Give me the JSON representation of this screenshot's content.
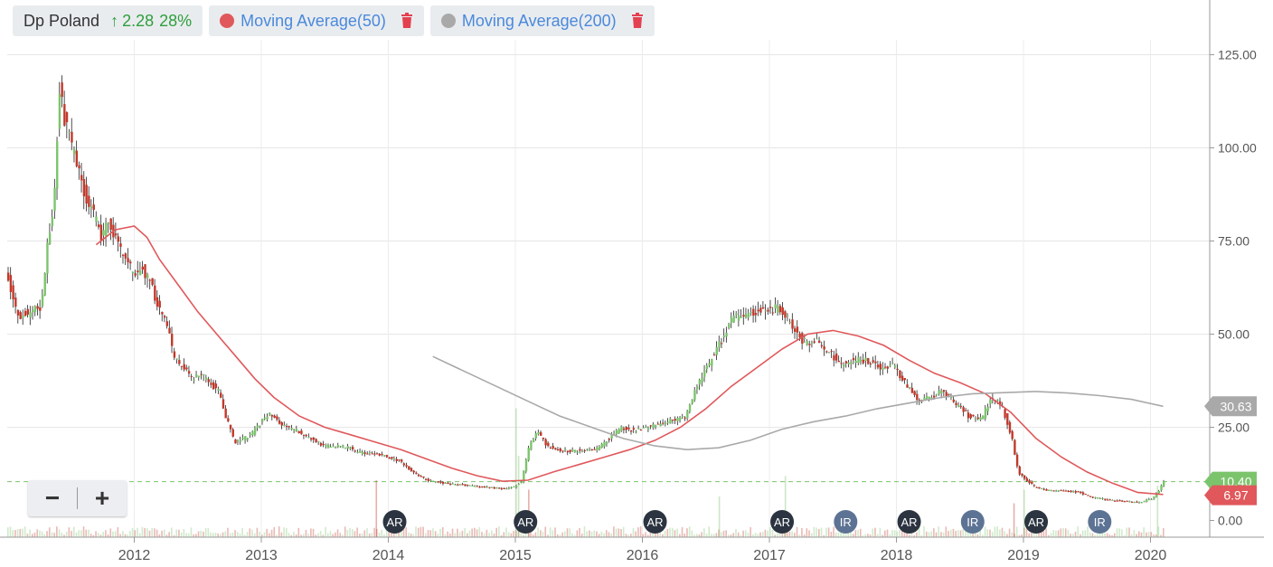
{
  "legend": {
    "ticker": "Dp Poland",
    "change_arrow": "↑",
    "change_value": "2.28",
    "change_pct": "28%",
    "ma50": {
      "label": "Moving Average(50)",
      "color": "#e0585b"
    },
    "ma200": {
      "label": "Moving Average(200)",
      "color": "#a9a9a9"
    }
  },
  "zoom": {
    "out_label": "−",
    "in_label": "+"
  },
  "chart_data": {
    "type": "candlestick",
    "x_axis": {
      "tick_labels": [
        "2012",
        "2013",
        "2014",
        "2015",
        "2016",
        "2017",
        "2018",
        "2019",
        "2020"
      ],
      "range": [
        2011.0,
        2020.27
      ]
    },
    "y_axis": {
      "position": "right",
      "tick_labels": [
        "125.00",
        "100.00",
        "75.00",
        "50.00",
        "25.00",
        "0.00"
      ],
      "range": [
        -3,
        135
      ]
    },
    "price_tags": [
      {
        "label": "30.63",
        "value": 30.63,
        "color": "#a9a9a9"
      },
      {
        "label": "10.40",
        "value": 10.4,
        "color": "#7cc46c"
      },
      {
        "label": "6.97",
        "value": 6.97,
        "color": "#e0585b"
      }
    ],
    "current_price_line": 10.4,
    "price_points": [
      [
        2011.0,
        68
      ],
      [
        2011.05,
        60
      ],
      [
        2011.1,
        55
      ],
      [
        2011.2,
        56
      ],
      [
        2011.28,
        57
      ],
      [
        2011.33,
        75
      ],
      [
        2011.38,
        85
      ],
      [
        2011.42,
        116
      ],
      [
        2011.48,
        105
      ],
      [
        2011.54,
        98
      ],
      [
        2011.6,
        90
      ],
      [
        2011.67,
        84
      ],
      [
        2011.75,
        76
      ],
      [
        2011.82,
        80
      ],
      [
        2011.88,
        74
      ],
      [
        2011.95,
        70
      ],
      [
        2012.0,
        66
      ],
      [
        2012.07,
        68
      ],
      [
        2012.13,
        64
      ],
      [
        2012.2,
        58
      ],
      [
        2012.27,
        52
      ],
      [
        2012.33,
        43
      ],
      [
        2012.4,
        41
      ],
      [
        2012.47,
        38
      ],
      [
        2012.54,
        39
      ],
      [
        2012.6,
        37
      ],
      [
        2012.67,
        35
      ],
      [
        2012.73,
        28
      ],
      [
        2012.8,
        21
      ],
      [
        2012.87,
        22
      ],
      [
        2012.93,
        23
      ],
      [
        2013.0,
        26
      ],
      [
        2013.07,
        29
      ],
      [
        2013.13,
        27
      ],
      [
        2013.2,
        25
      ],
      [
        2013.3,
        24
      ],
      [
        2013.4,
        22
      ],
      [
        2013.5,
        20
      ],
      [
        2013.6,
        20
      ],
      [
        2013.7,
        19.5
      ],
      [
        2013.8,
        18
      ],
      [
        2013.9,
        18
      ],
      [
        2014.0,
        17
      ],
      [
        2014.1,
        16
      ],
      [
        2014.2,
        13
      ],
      [
        2014.3,
        11
      ],
      [
        2014.45,
        10
      ],
      [
        2014.6,
        9.5
      ],
      [
        2014.75,
        9
      ],
      [
        2014.9,
        8.5
      ],
      [
        2015.0,
        9
      ],
      [
        2015.06,
        10.5
      ],
      [
        2015.12,
        20
      ],
      [
        2015.18,
        24
      ],
      [
        2015.26,
        20
      ],
      [
        2015.35,
        19
      ],
      [
        2015.45,
        18.5
      ],
      [
        2015.55,
        19
      ],
      [
        2015.65,
        19
      ],
      [
        2015.75,
        22
      ],
      [
        2015.85,
        25
      ],
      [
        2015.95,
        24
      ],
      [
        2016.05,
        25
      ],
      [
        2016.15,
        26
      ],
      [
        2016.25,
        27
      ],
      [
        2016.35,
        28
      ],
      [
        2016.45,
        37
      ],
      [
        2016.53,
        42
      ],
      [
        2016.6,
        46
      ],
      [
        2016.66,
        50
      ],
      [
        2016.72,
        54
      ],
      [
        2016.8,
        55
      ],
      [
        2016.88,
        56
      ],
      [
        2016.95,
        57
      ],
      [
        2017.05,
        57
      ],
      [
        2017.12,
        56
      ],
      [
        2017.2,
        52
      ],
      [
        2017.28,
        48
      ],
      [
        2017.38,
        48
      ],
      [
        2017.48,
        45
      ],
      [
        2017.58,
        42
      ],
      [
        2017.68,
        43
      ],
      [
        2017.78,
        43
      ],
      [
        2017.88,
        41
      ],
      [
        2017.98,
        42
      ],
      [
        2018.08,
        37
      ],
      [
        2018.18,
        32
      ],
      [
        2018.28,
        33
      ],
      [
        2018.38,
        35
      ],
      [
        2018.48,
        31
      ],
      [
        2018.58,
        28
      ],
      [
        2018.68,
        27
      ],
      [
        2018.76,
        33
      ],
      [
        2018.84,
        31
      ],
      [
        2018.92,
        22
      ],
      [
        2018.97,
        13
      ],
      [
        2019.03,
        11
      ],
      [
        2019.1,
        9
      ],
      [
        2019.2,
        8
      ],
      [
        2019.32,
        8
      ],
      [
        2019.45,
        7.5
      ],
      [
        2019.58,
        6
      ],
      [
        2019.7,
        5.5
      ],
      [
        2019.85,
        5
      ],
      [
        2019.95,
        5
      ],
      [
        2020.03,
        6
      ],
      [
        2020.08,
        8.1
      ],
      [
        2020.11,
        10.4
      ]
    ],
    "series": [
      {
        "name": "Moving Average(50)",
        "color": "#e0585b",
        "points": [
          [
            2011.7,
            74
          ],
          [
            2011.85,
            78
          ],
          [
            2012.0,
            79
          ],
          [
            2012.1,
            76
          ],
          [
            2012.2,
            70
          ],
          [
            2012.35,
            63
          ],
          [
            2012.5,
            56
          ],
          [
            2012.65,
            50
          ],
          [
            2012.8,
            44
          ],
          [
            2012.95,
            38
          ],
          [
            2013.1,
            33
          ],
          [
            2013.3,
            28
          ],
          [
            2013.5,
            25
          ],
          [
            2013.7,
            23
          ],
          [
            2013.9,
            21
          ],
          [
            2014.1,
            19
          ],
          [
            2014.3,
            16.5
          ],
          [
            2014.5,
            14
          ],
          [
            2014.7,
            12
          ],
          [
            2014.9,
            10.5
          ],
          [
            2015.1,
            10.8
          ],
          [
            2015.3,
            13
          ],
          [
            2015.5,
            15
          ],
          [
            2015.7,
            17
          ],
          [
            2015.9,
            19
          ],
          [
            2016.1,
            21.5
          ],
          [
            2016.3,
            25
          ],
          [
            2016.5,
            30
          ],
          [
            2016.7,
            36
          ],
          [
            2016.9,
            41
          ],
          [
            2017.1,
            46
          ],
          [
            2017.3,
            50
          ],
          [
            2017.5,
            51
          ],
          [
            2017.7,
            49.5
          ],
          [
            2017.9,
            47
          ],
          [
            2018.1,
            43
          ],
          [
            2018.3,
            39.5
          ],
          [
            2018.5,
            37
          ],
          [
            2018.7,
            34
          ],
          [
            2018.9,
            29
          ],
          [
            2019.1,
            22
          ],
          [
            2019.3,
            17
          ],
          [
            2019.5,
            13
          ],
          [
            2019.7,
            10
          ],
          [
            2019.9,
            7.5
          ],
          [
            2020.1,
            6.97
          ]
        ]
      },
      {
        "name": "Moving Average(200)",
        "color": "#a9a9a9",
        "points": [
          [
            2014.35,
            44
          ],
          [
            2014.6,
            40
          ],
          [
            2014.85,
            36
          ],
          [
            2015.1,
            32
          ],
          [
            2015.35,
            28
          ],
          [
            2015.6,
            25
          ],
          [
            2015.85,
            22
          ],
          [
            2016.1,
            20
          ],
          [
            2016.35,
            19
          ],
          [
            2016.6,
            19.5
          ],
          [
            2016.85,
            21.5
          ],
          [
            2017.1,
            24.5
          ],
          [
            2017.35,
            26.5
          ],
          [
            2017.6,
            28
          ],
          [
            2017.85,
            30
          ],
          [
            2018.1,
            31.5
          ],
          [
            2018.35,
            33
          ],
          [
            2018.6,
            34
          ],
          [
            2018.85,
            34.3
          ],
          [
            2019.1,
            34.6
          ],
          [
            2019.35,
            34.2
          ],
          [
            2019.6,
            33.5
          ],
          [
            2019.85,
            32.5
          ],
          [
            2020.1,
            30.63
          ]
        ]
      }
    ],
    "events": [
      {
        "label": "AR",
        "x": 2014.05
      },
      {
        "label": "AR",
        "x": 2015.08
      },
      {
        "label": "AR",
        "x": 2016.1
      },
      {
        "label": "AR",
        "x": 2017.1
      },
      {
        "label": "IR",
        "x": 2017.6
      },
      {
        "label": "AR",
        "x": 2018.1
      },
      {
        "label": "IR",
        "x": 2018.6
      },
      {
        "label": "AR",
        "x": 2019.1
      },
      {
        "label": "IR",
        "x": 2019.6
      }
    ],
    "event_colors": {
      "AR": "#2b3440",
      "IR": "#5d7394"
    },
    "candle_colors": {
      "up": "#7cc46c",
      "down": "#c1392b"
    },
    "volume_spikes": [
      {
        "x": 2013.9,
        "v": 0.42,
        "up": false
      },
      {
        "x": 2015.0,
        "v": 0.95,
        "up": true
      },
      {
        "x": 2015.02,
        "v": 0.6,
        "up": true
      },
      {
        "x": 2015.1,
        "v": 0.35,
        "up": false
      },
      {
        "x": 2016.6,
        "v": 0.3,
        "up": true
      },
      {
        "x": 2017.12,
        "v": 0.45,
        "up": true
      },
      {
        "x": 2018.92,
        "v": 0.25,
        "up": false
      },
      {
        "x": 2019.0,
        "v": 0.35,
        "up": true
      },
      {
        "x": 2020.05,
        "v": 0.38,
        "up": true
      }
    ]
  }
}
